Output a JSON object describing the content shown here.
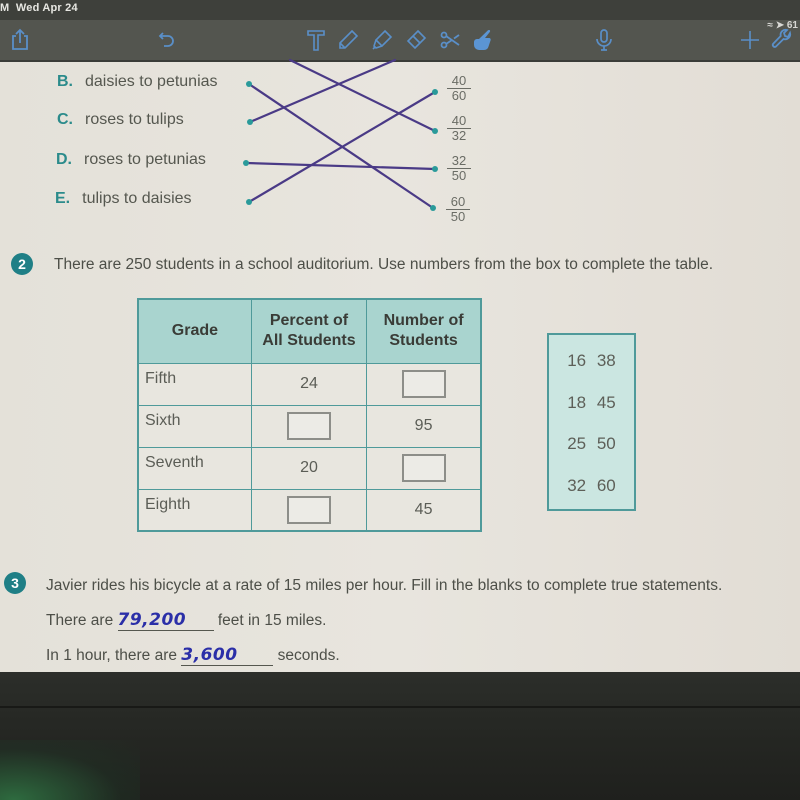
{
  "status_bar": {
    "time_fragment": "M",
    "date": "Wed Apr 24",
    "battery_fragment": "61"
  },
  "toolbar": {
    "tools": [
      {
        "name": "share",
        "icon": "share-icon"
      },
      {
        "name": "undo",
        "icon": "undo-icon"
      },
      {
        "name": "text",
        "icon": "text-tool-icon"
      },
      {
        "name": "pen",
        "icon": "pen-icon"
      },
      {
        "name": "highlighter",
        "icon": "highlighter-icon"
      },
      {
        "name": "eraser",
        "icon": "eraser-icon"
      },
      {
        "name": "scissors",
        "icon": "scissors-icon"
      },
      {
        "name": "hand",
        "icon": "hand-pointer-icon",
        "active": true
      },
      {
        "name": "microphone",
        "icon": "microphone-icon"
      },
      {
        "name": "add",
        "icon": "plus-icon"
      },
      {
        "name": "settings",
        "icon": "wrench-icon"
      }
    ],
    "icon_color": "#5a8fc8"
  },
  "matching": {
    "left_items": [
      {
        "letter": "B.",
        "text": "daisies to petunias"
      },
      {
        "letter": "C.",
        "text": "roses to tulips"
      },
      {
        "letter": "D.",
        "text": "roses to petunias"
      },
      {
        "letter": "E.",
        "text": "tulips to daisies"
      }
    ],
    "right_items": [
      {
        "numerator": "40",
        "denominator": "60"
      },
      {
        "numerator": "40",
        "denominator": "32"
      },
      {
        "numerator": "32",
        "denominator": "50"
      },
      {
        "numerator": "60",
        "denominator": "50"
      }
    ],
    "connections": [
      {
        "from": "B.",
        "to": "60/50"
      },
      {
        "from": "C.",
        "to": "offscreen-top"
      },
      {
        "from": "D.",
        "to": "32/50"
      },
      {
        "from": "E.",
        "to": "40/60"
      },
      {
        "from": "offscreen-top",
        "to": "40/32"
      }
    ],
    "line_color": "#4a3a86",
    "dot_color": "#2a9a9a"
  },
  "question2": {
    "number": "2",
    "prompt": "There are 250 students in a school auditorium. Use numbers from the box to complete the table.",
    "table": {
      "headers": [
        "Grade",
        "Percent of All Students",
        "Number of Students"
      ],
      "header_lines": [
        [
          "Grade"
        ],
        [
          "Percent of",
          "All Students"
        ],
        [
          "Number of",
          "Students"
        ]
      ],
      "rows": [
        {
          "grade": "Fifth",
          "percent": "24",
          "number": ""
        },
        {
          "grade": "Sixth",
          "percent": "",
          "number": "95"
        },
        {
          "grade": "Seventh",
          "percent": "20",
          "number": ""
        },
        {
          "grade": "Eighth",
          "percent": "",
          "number": "45"
        }
      ]
    },
    "number_box": {
      "rows": [
        "16 38",
        "18 45",
        "25 50",
        "32 60"
      ]
    }
  },
  "question3": {
    "number": "3",
    "prompt": "Javier rides his bicycle at a rate of 15 miles per hour. Fill in the blanks to complete true statements.",
    "statements": [
      {
        "before": "There are",
        "answer": "79,200",
        "after": "feet in 15 miles."
      },
      {
        "before": "In 1 hour, there are",
        "answer": "3,600",
        "after": "seconds."
      }
    ]
  },
  "colors": {
    "accent_teal": "#1f7f86",
    "table_header": "#a9d4cf",
    "handwriting_ink": "#2b2fa8",
    "toolbar_bg": "#53554f"
  }
}
